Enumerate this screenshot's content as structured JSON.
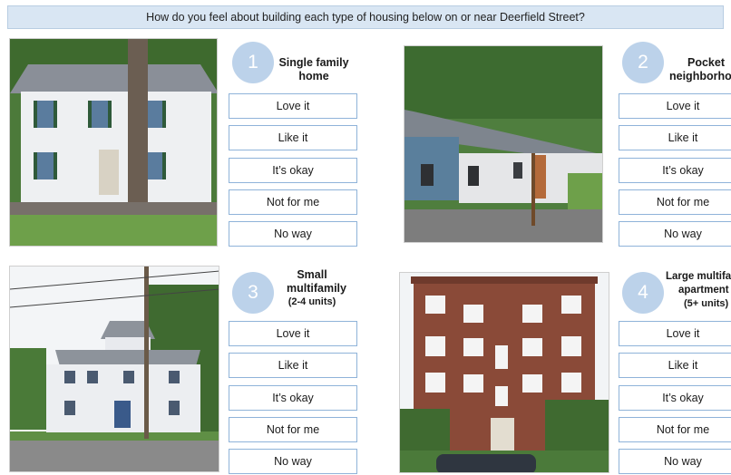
{
  "header": {
    "question": "How do you feel about building each type of housing below on or near Deerfield Street?"
  },
  "options": [
    "Love it",
    "Like it",
    "It’s okay",
    "Not for me",
    "No way"
  ],
  "cards": [
    {
      "number": "1",
      "title_lines": [
        "Single family",
        "home"
      ]
    },
    {
      "number": "2",
      "title_lines": [
        "Pocket",
        "neighborho"
      ]
    },
    {
      "number": "3",
      "title_lines": [
        "Small",
        "multifamily",
        "(2-4 units)"
      ]
    },
    {
      "number": "4",
      "title_lines": [
        "Large multifa",
        "apartment",
        "(5+ units)"
      ]
    }
  ]
}
